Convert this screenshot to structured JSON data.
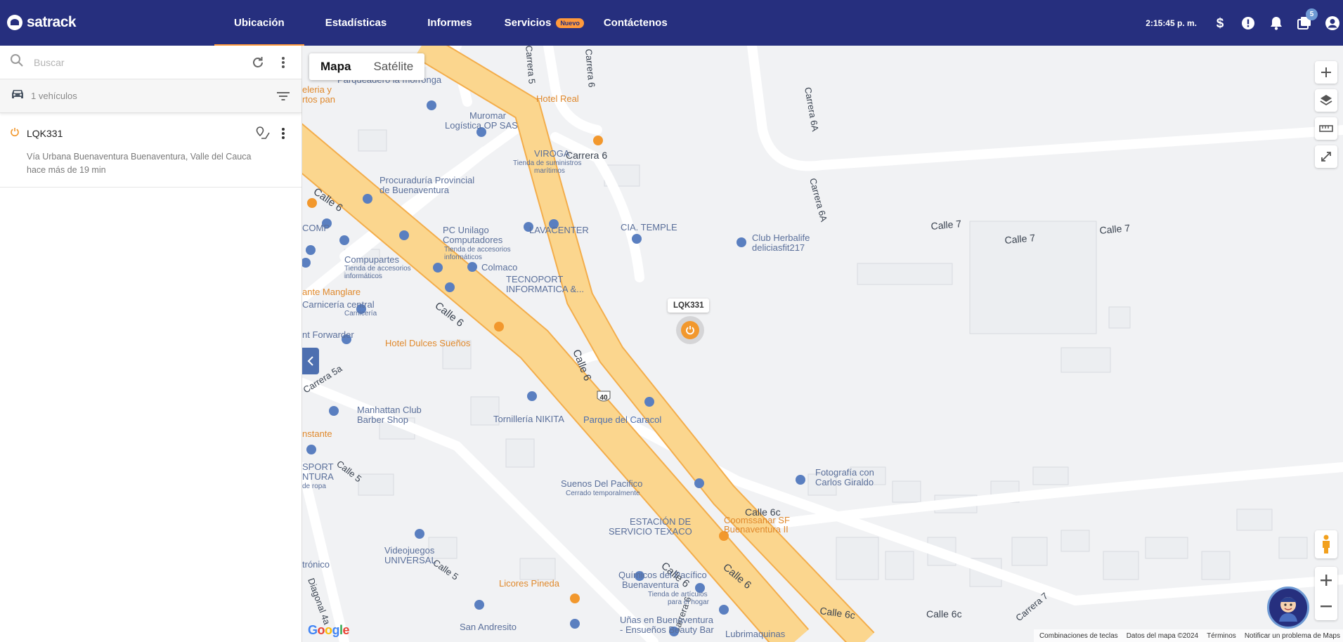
{
  "header": {
    "brand": "satrack",
    "nav": [
      {
        "label": "Ubicación",
        "active": true
      },
      {
        "label": "Estadísticas"
      },
      {
        "label": "Informes"
      },
      {
        "label": "Servicios",
        "badge": "Nuevo"
      },
      {
        "label": "Contáctenos"
      }
    ],
    "clock": "2:15:45 p. m.",
    "icons": [
      "dollar-icon",
      "alert-icon",
      "bell-icon",
      "messages-icon",
      "user-icon"
    ],
    "messages_count": "5"
  },
  "sidebar": {
    "search_placeholder": "Buscar",
    "vehicle_count": "1 vehículos",
    "vehicles": [
      {
        "plate": "LQK331",
        "address": "Vía Urbana Buenaventura Buenaventura, Valle del Cauca",
        "last_update": "hace más de 19 min"
      }
    ]
  },
  "map": {
    "type_map": "Mapa",
    "type_satellite": "Satélite",
    "vehicle_label": "LQK331",
    "google": "Google",
    "footer": {
      "shortcuts": "Combinaciones de teclas",
      "data": "Datos del mapa ©2024",
      "terms": "Términos",
      "report": "Notificar un problema de Maps"
    },
    "places": [
      {
        "name": "Parqueadero la morronga"
      },
      {
        "name": "Hotel Real"
      },
      {
        "name": "Muromar Logística OP SAS"
      },
      {
        "name": "VIROGA",
        "sub": "Tienda de suministros marítimos"
      },
      {
        "name": "Procuraduría Provincial de Buenaventura"
      },
      {
        "name": "PC Unilago Computadores",
        "sub": "Tienda de accesorios informáticos"
      },
      {
        "name": "LAVACENTER"
      },
      {
        "name": "CIA. TEMPLE"
      },
      {
        "name": "Club Herbalife deliciasfit217"
      },
      {
        "name": "Compupartes",
        "sub": "Tienda de accesorios informáticos"
      },
      {
        "name": "Colmaco"
      },
      {
        "name": "TECNOPORT INFORMATICA &..."
      },
      {
        "name": "Carnicería central",
        "sub": "Carnicería"
      },
      {
        "name": "nt Forwarder"
      },
      {
        "name": "Hotel Dulces Sueños"
      },
      {
        "name": "Manhattan Club Barber Shop"
      },
      {
        "name": "Tornillería NIKITA"
      },
      {
        "name": "Parque del Caracol"
      },
      {
        "name": "Suenos Del Pacifico",
        "sub": "Cerrado temporalmente"
      },
      {
        "name": "ESTACIÓN DE SERVICIO TEXACO"
      },
      {
        "name": "Coomssanar SF Buenaventura II"
      },
      {
        "name": "Fotografía con Carlos Giraldo"
      },
      {
        "name": "Videojuegos UNIVERSAL"
      },
      {
        "name": "Licores Pineda"
      },
      {
        "name": "Químicos del Pacífico Buenaventura",
        "sub": "Tienda de artículos para el hogar"
      },
      {
        "name": "San Andresito"
      },
      {
        "name": "Uñas en Buenaventura - Ensueños Beauty Bar"
      },
      {
        "name": "Lubrimaquinas"
      }
    ],
    "streets": [
      "Carrera 5",
      "Carrera 6",
      "Carrera 6A",
      "Calle 6",
      "Calle 7",
      "Calle 6c",
      "Carrera 5a",
      "Calle 5",
      "Diagonal 4a",
      "Carrera 7"
    ],
    "route_shield": "40",
    "partial_labels": [
      "eleria y",
      "rtos pan",
      "COMP",
      "ante Manglare",
      "nstante",
      "SPORT",
      "NTURA",
      "de ropa",
      "trónico"
    ]
  }
}
